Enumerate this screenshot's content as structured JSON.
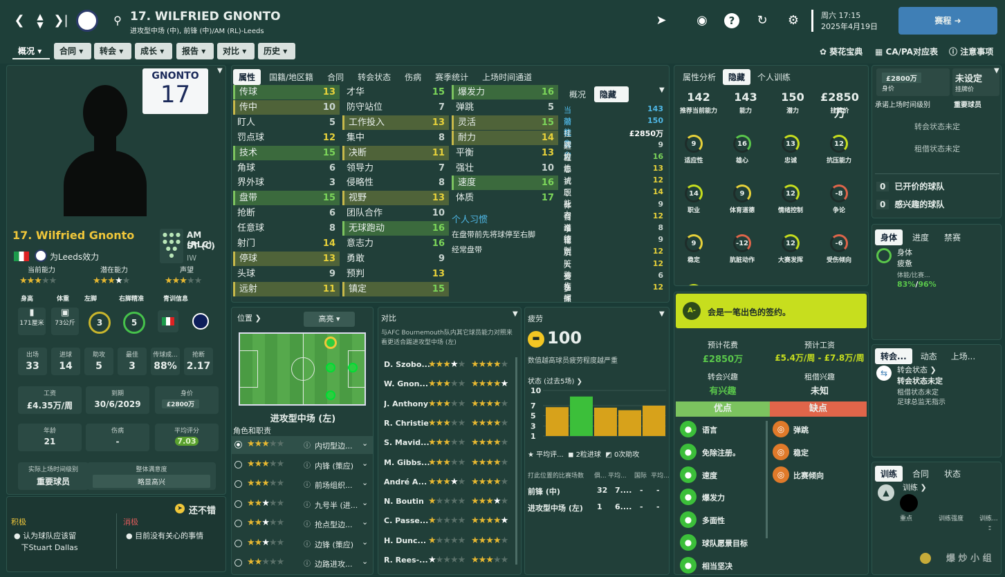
{
  "header": {
    "number_name": "17. WILFRIED GNONTO",
    "positions": "进攻型中场 (中), 前锋 (中)/AM (RL)-Leeds",
    "date_day": "周六 17:15",
    "date": "2025年4月19日",
    "continue_label": "赛程"
  },
  "menus": [
    "概况",
    "合同",
    "转会",
    "成长",
    "报告",
    "对比",
    "历史"
  ],
  "top_links": {
    "gem": "葵花宝典",
    "capa": "CA/PA对应表",
    "notes": "注意事项"
  },
  "profile": {
    "shirt_name": "GNONTO",
    "shirt_number": "17",
    "name": "17. Wilfried Gnonto",
    "team": "为Leeds效力",
    "pos_main": "AM (RLC),",
    "pos_sub": "ST (C)",
    "role": "IW",
    "ca_label": "当前能力",
    "pa_label": "潜在能力",
    "rep_label": "声望",
    "bio_labels": [
      "身高",
      "体重",
      "左脚",
      "右脚精准",
      "青训信息"
    ],
    "height": "171厘米",
    "weight": "73公斤",
    "left_foot": "3",
    "right_foot": "5",
    "stats": [
      {
        "l": "出场",
        "v": "33"
      },
      {
        "l": "进球",
        "v": "14"
      },
      {
        "l": "助攻",
        "v": "5"
      },
      {
        "l": "最佳",
        "v": "3"
      },
      {
        "l": "传球成...",
        "v": "88%"
      },
      {
        "l": "抢断",
        "v": "2.17"
      }
    ],
    "wage_l": "工资",
    "wage": "£4.35万/周",
    "exp_l": "到期",
    "exp": "30/6/2029",
    "value_l": "身价",
    "value": "£2800万",
    "age_l": "年龄",
    "age": "21",
    "inj_l": "伤病",
    "inj": "-",
    "rating_l": "平均评分",
    "rating": "7.03",
    "role_l": "实际上场时间级别",
    "role_v": "重要球员",
    "happy_l": "整体满意度",
    "happy_v": "略显高兴",
    "mood": "还不错",
    "pos_title": "积极",
    "pos_text1": "认为球队应该留",
    "pos_text2": "下Stuart Dallas",
    "neg_title": "消极",
    "neg_text": "目前没有关心的事情"
  },
  "attr_tabs": [
    "属性",
    "国籍/地区籍",
    "合同",
    "转会状态",
    "伤病",
    "赛季统计",
    "上场时间通道"
  ],
  "attrs_tech": [
    [
      "传球",
      "13",
      "hl"
    ],
    [
      "传中",
      "10",
      "hl2"
    ],
    [
      "盯人",
      "5",
      ""
    ],
    [
      "罚点球",
      "12",
      ""
    ],
    [
      "技术",
      "15",
      "hl"
    ],
    [
      "角球",
      "6",
      ""
    ],
    [
      "界外球",
      "3",
      ""
    ],
    [
      "盘带",
      "15",
      "hl"
    ],
    [
      "抢断",
      "6",
      ""
    ],
    [
      "任意球",
      "8",
      ""
    ],
    [
      "射门",
      "14",
      ""
    ],
    [
      "停球",
      "13",
      "hl2"
    ],
    [
      "头球",
      "9",
      ""
    ],
    [
      "远射",
      "11",
      "hl2"
    ]
  ],
  "attrs_mental": [
    [
      "才华",
      "15",
      ""
    ],
    [
      "防守站位",
      "7",
      ""
    ],
    [
      "工作投入",
      "13",
      "hl2"
    ],
    [
      "集中",
      "8",
      ""
    ],
    [
      "决断",
      "11",
      "hl2"
    ],
    [
      "领导力",
      "7",
      ""
    ],
    [
      "侵略性",
      "8",
      ""
    ],
    [
      "视野",
      "13",
      "hl2"
    ],
    [
      "团队合作",
      "10",
      ""
    ],
    [
      "无球跑动",
      "16",
      "hl"
    ],
    [
      "意志力",
      "16",
      ""
    ],
    [
      "勇敢",
      "9",
      ""
    ],
    [
      "预判",
      "13",
      ""
    ],
    [
      "镇定",
      "15",
      "hl2"
    ]
  ],
  "attrs_phys": [
    [
      "爆发力",
      "16",
      "hl"
    ],
    [
      "弹跳",
      "5",
      ""
    ],
    [
      "灵活",
      "15",
      "hl2"
    ],
    [
      "耐力",
      "14",
      "hl2"
    ],
    [
      "平衡",
      "13",
      ""
    ],
    [
      "强壮",
      "10",
      ""
    ],
    [
      "速度",
      "16",
      "hl"
    ],
    [
      "体质",
      "17",
      ""
    ]
  ],
  "habits_title": "个人习惯",
  "habits": [
    "在盘带前先将球停至右脚",
    "经常盘带"
  ],
  "hidden_tabs": [
    "概况",
    "隐藏"
  ],
  "hidden": [
    [
      "当前能力",
      "143"
    ],
    [
      "潜在能力",
      "150"
    ],
    [
      "挂牌价",
      "£2850万"
    ],
    [
      "适应性",
      "9"
    ],
    [
      "雄心",
      "16"
    ],
    [
      "忠诚",
      "13"
    ],
    [
      "抗压能力",
      "12"
    ],
    [
      "职业",
      "14"
    ],
    [
      "体育道德",
      "9"
    ],
    [
      "情绪控制",
      "12"
    ],
    [
      "争论",
      "8"
    ],
    [
      "稳定",
      "9"
    ],
    [
      "肮脏动作",
      "12"
    ],
    [
      "大赛发挥",
      "12"
    ],
    [
      "受伤倾向",
      "6"
    ],
    [
      "多面性",
      "12"
    ]
  ],
  "analysis_tabs": [
    "属性分析",
    "隐藏",
    "个人训练"
  ],
  "analysis_top": [
    {
      "v": "142",
      "l": "推荐当前能力"
    },
    {
      "v": "143",
      "l": "能力"
    },
    {
      "v": "150",
      "l": "潜力"
    },
    {
      "v": "£2850万",
      "l": "挂牌价"
    }
  ],
  "gauges": [
    [
      "9",
      "适应性"
    ],
    [
      "16",
      "雄心"
    ],
    [
      "13",
      "忠诚"
    ],
    [
      "12",
      "抗压能力"
    ],
    [
      "14",
      "职业"
    ],
    [
      "9",
      "体育道德"
    ],
    [
      "12",
      "情绪控制"
    ],
    [
      "-8",
      "争论"
    ],
    [
      "9",
      "稳定"
    ],
    [
      "-12",
      "肮脏动作"
    ],
    [
      "12",
      "大赛发挥"
    ],
    [
      "-6",
      "受伤倾向"
    ],
    [
      "12",
      "多面性"
    ]
  ],
  "transfer_box": {
    "value": "£2800万",
    "value_l": "身价",
    "unset": "未设定",
    "unset_l": "挂牌价",
    "promise_l": "承诺上场时间级别",
    "promise_v": "重要球员",
    "status1": "转会状态未定",
    "status2": "租借状态未定",
    "offers": [
      [
        "0",
        "已开价的球队"
      ],
      [
        "0",
        "感兴趣的球队"
      ]
    ]
  },
  "body_tabs": [
    "身体",
    "进度",
    "禁赛"
  ],
  "body": {
    "title": "身体",
    "state": "疲惫",
    "sub": "体能/比赛...",
    "v1": "83%",
    "v2": "96%"
  },
  "transfer_tabs": [
    "转会...",
    "动态",
    "上场..."
  ],
  "transfer_news": {
    "t1": "转会状态",
    "t2": "转会状态未定",
    "t3": "租借状态未定",
    "t4": "足球总监无指示"
  },
  "train_tabs": [
    "训练",
    "合同",
    "状态"
  ],
  "training": {
    "t": "训练",
    "focus": "重点",
    "intensity": "训练强度",
    "more": "训练...",
    "d1": "-",
    "d2": "-"
  },
  "position": {
    "title": "位置",
    "mode": "高亮",
    "role_name": "进攻型中场 (左)",
    "roles_title": "角色和职责",
    "roles": [
      [
        "内切型边...",
        "3"
      ],
      [
        "内锋 (策应)",
        "3"
      ],
      [
        "前场组织...",
        "3"
      ],
      [
        "九号半 (进...",
        "2.5"
      ],
      [
        "抢点型边...",
        "2.5"
      ],
      [
        "边锋 (策应)",
        "2.5"
      ],
      [
        "边路进攻...",
        "2"
      ]
    ]
  },
  "compare": {
    "title": "对比",
    "desc": "与AFC Bournemouth队内其它球员能力对照来看更适合踢进攻型中场 (左)",
    "rows": [
      [
        "D. Szobo...",
        "3.5",
        "4"
      ],
      [
        "W. Gnon...",
        "3",
        "4.5"
      ],
      [
        "J. Anthony",
        "3",
        "4"
      ],
      [
        "R. Christie",
        "3",
        "4"
      ],
      [
        "S. Mavid...",
        "3",
        "4"
      ],
      [
        "M. Gibbs...",
        "3",
        "4"
      ],
      [
        "André A...",
        "3.5",
        "4"
      ],
      [
        "N. Boutin",
        "1",
        "3.5"
      ],
      [
        "C. Passe...",
        "1",
        "4.5"
      ],
      [
        "H. Dunc...",
        "1",
        "4"
      ],
      [
        "R. Rees-...",
        "0.5",
        "3"
      ]
    ]
  },
  "fatigue": {
    "title": "疲劳",
    "value": "100",
    "desc": "数值越高球员疲劳程度越严重",
    "form_title": "状态 (过去5场)",
    "chart_data": {
      "type": "bar",
      "values": [
        6.7,
        8.8,
        6.6,
        6.1,
        7.0
      ],
      "ylim": [
        1,
        10
      ],
      "ticks": [
        "10",
        "7",
        "5",
        "3",
        "1"
      ]
    },
    "legend": [
      "平均评...",
      "2粒进球",
      "0次助攻"
    ],
    "table_head": [
      "打此位置的比赛场数",
      "俱...",
      "平均...",
      "国际",
      "平均..."
    ],
    "rows": [
      [
        "前锋 (中)",
        "32",
        "7....",
        "-",
        "-"
      ],
      [
        "进攻型中场 (左)",
        "1",
        "6....",
        "-",
        "-"
      ]
    ]
  },
  "scout": {
    "grade": "A-",
    "text": "会是一笔出色的签约。",
    "fee_l": "预计花费",
    "fee": "£2850万",
    "wage_l": "预计工资",
    "wage": "£5.4万/周 - £7.8万/周",
    "ti_l": "转会兴趣",
    "ti": "有兴趣",
    "li_l": "租借兴趣",
    "li": "未知",
    "pros_l": "优点",
    "cons_l": "缺点",
    "pros": [
      "语言",
      "免除注册。",
      "速度",
      "爆发力",
      "多面性",
      "球队愿景目标",
      "相当坚决"
    ],
    "cons": [
      "弹跳",
      "稳定",
      "比赛倾向"
    ]
  },
  "watermark": "爆 炒 小 组"
}
